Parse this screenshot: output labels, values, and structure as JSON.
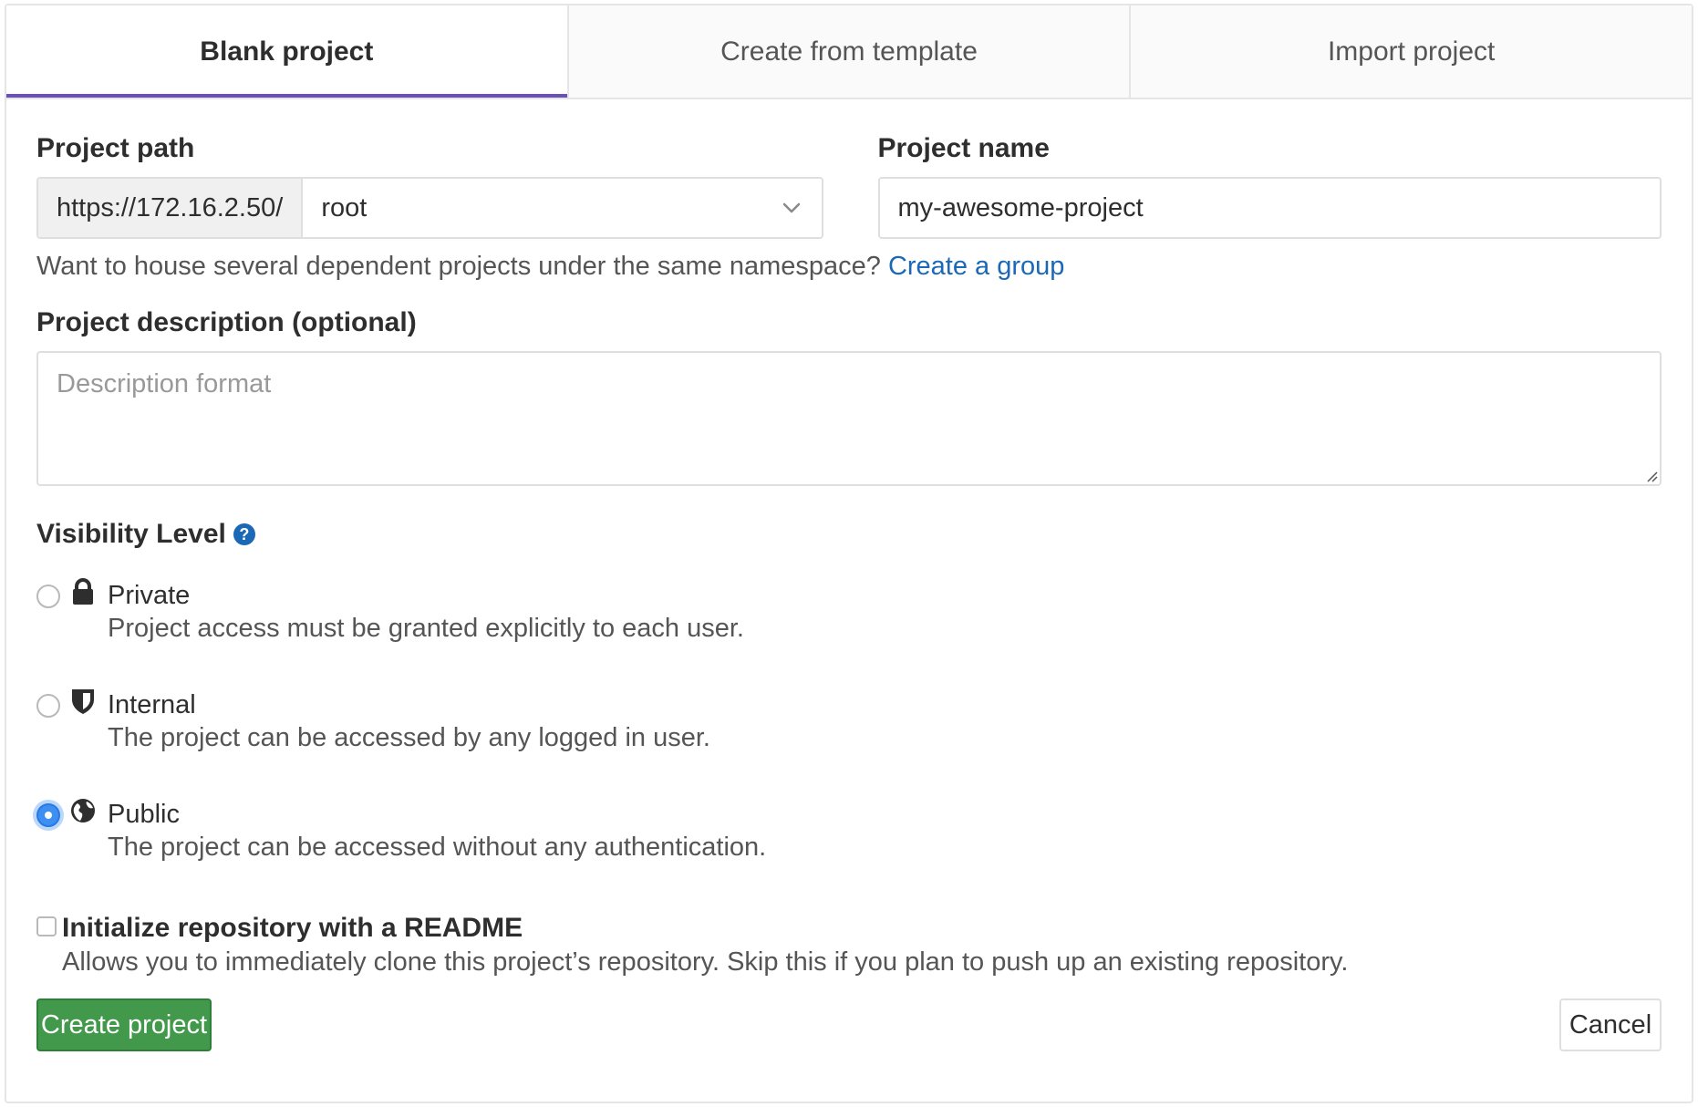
{
  "tabs": [
    {
      "label": "Blank project",
      "active": true
    },
    {
      "label": "Create from template",
      "active": false
    },
    {
      "label": "Import project",
      "active": false
    }
  ],
  "project_path": {
    "label": "Project path",
    "url_prefix": "https://172.16.2.50/",
    "namespace": "root",
    "namespace_icon": "chevron-down-icon"
  },
  "project_name": {
    "label": "Project name",
    "value": "my-awesome-project"
  },
  "namespace_help": {
    "text": "Want to house several dependent projects under the same namespace?",
    "link": "Create a group"
  },
  "description": {
    "label": "Project description (optional)",
    "placeholder": "Description format"
  },
  "visibility": {
    "label": "Visibility Level",
    "help_icon": "question-circle-icon",
    "options": [
      {
        "name": "Private",
        "description": "Project access must be granted explicitly to each user.",
        "icon": "lock-icon",
        "checked": false
      },
      {
        "name": "Internal",
        "description": "The project can be accessed by any logged in user.",
        "icon": "shield-icon",
        "checked": false
      },
      {
        "name": "Public",
        "description": "The project can be accessed without any authentication.",
        "icon": "globe-icon",
        "checked": true
      }
    ]
  },
  "readme": {
    "label": "Initialize repository with a README",
    "help": "Allows you to immediately clone this project’s repository. Skip this if you plan to push up an existing repository.",
    "checked": false
  },
  "actions": {
    "create_label": "Create project",
    "cancel_label": "Cancel"
  },
  "colors": {
    "accent": "#6b4fbb",
    "link": "#1b69b6",
    "primary_button": "#42994c",
    "radio_checked": "#3d8ff2"
  }
}
